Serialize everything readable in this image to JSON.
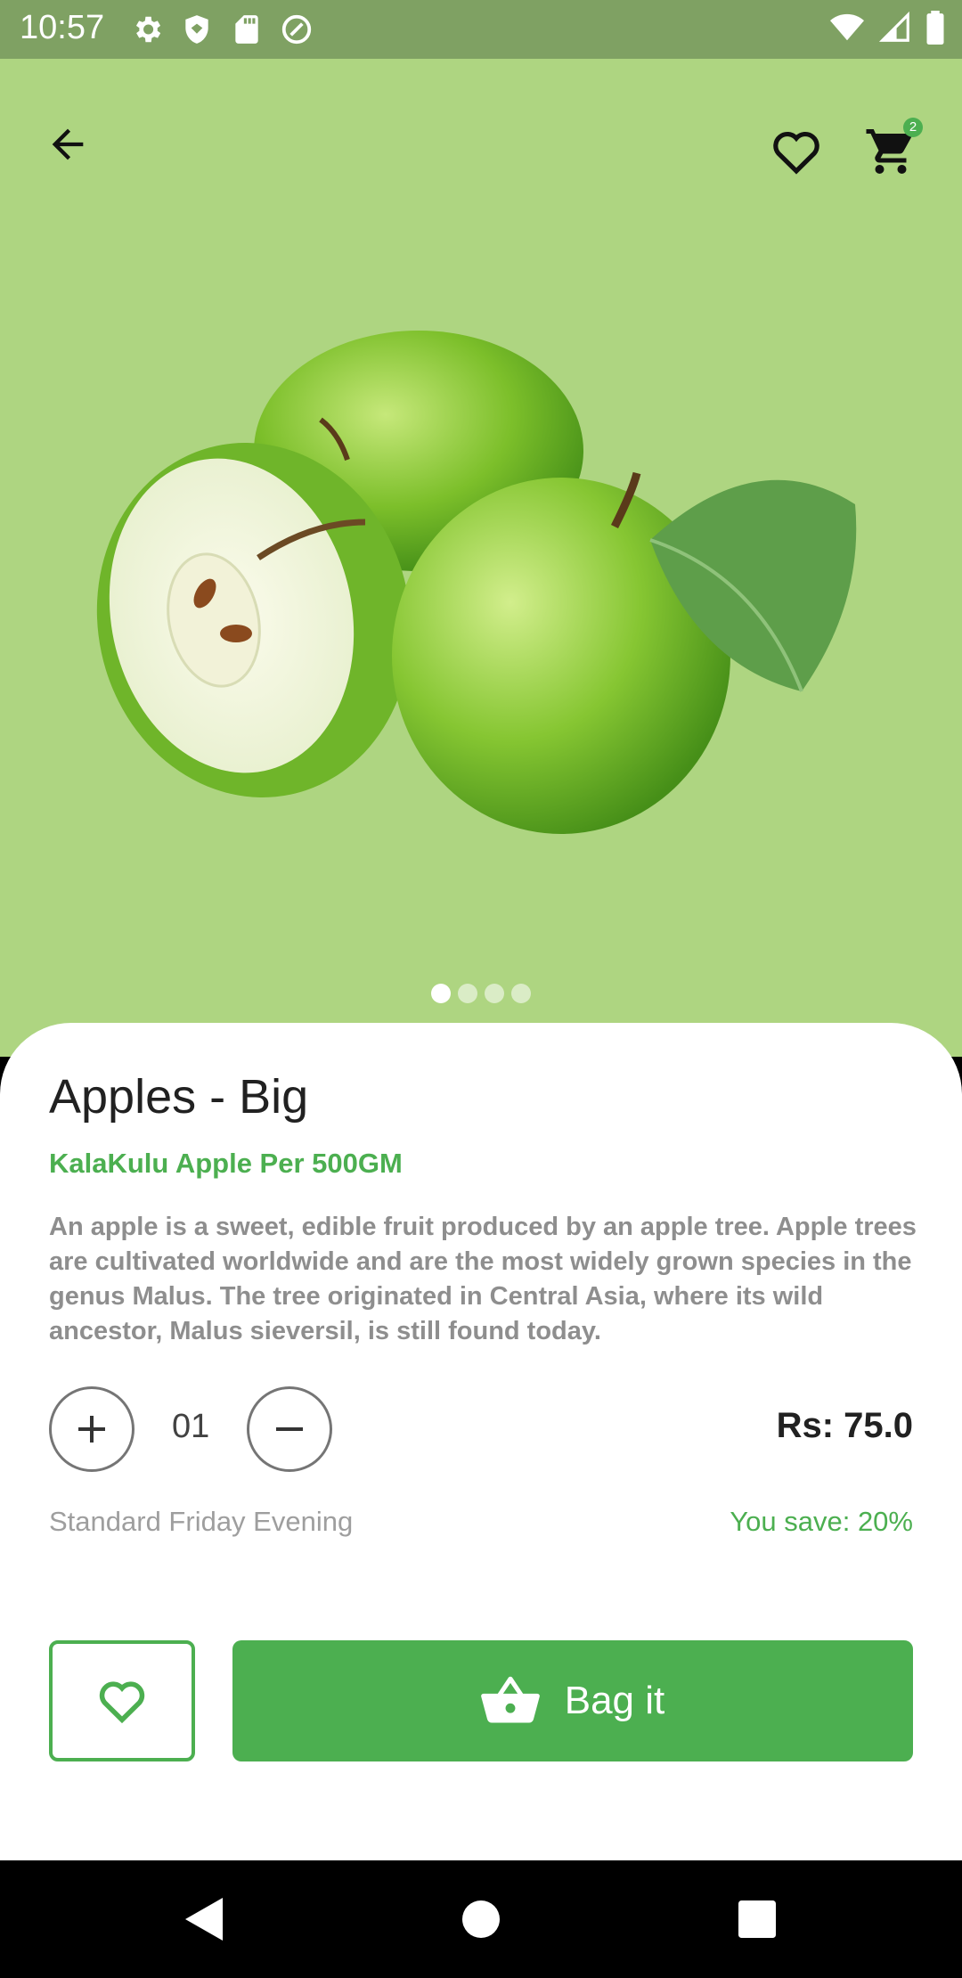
{
  "status_bar": {
    "time": "10:57",
    "icons_left": [
      "settings-icon",
      "shield-icon",
      "sd-card-icon",
      "at-sign-icon"
    ],
    "icons_right": [
      "wifi-icon",
      "signal-icon",
      "battery-icon"
    ]
  },
  "header": {
    "cart_count": "2"
  },
  "gallery": {
    "image_count": 4,
    "active_index": 0
  },
  "product": {
    "title": "Apples - Big",
    "subtitle": "KalaKulu Apple Per 500GM",
    "description": "An apple is a sweet, edible fruit produced by an apple tree. Apple trees are cultivated worldwide and are the most widely grown species in the genus Malus. The tree originated in Central Asia, where its wild ancestor, Malus sieversil, is still found today.",
    "quantity": "01",
    "price": "Rs: 75.0",
    "delivery": "Standard Friday Evening",
    "savings": "You save: 20%"
  },
  "actions": {
    "bag_label": "Bag it"
  },
  "colors": {
    "accent": "#4caf50",
    "hero_bg": "#aed581",
    "status_bar": "#7fa163"
  }
}
